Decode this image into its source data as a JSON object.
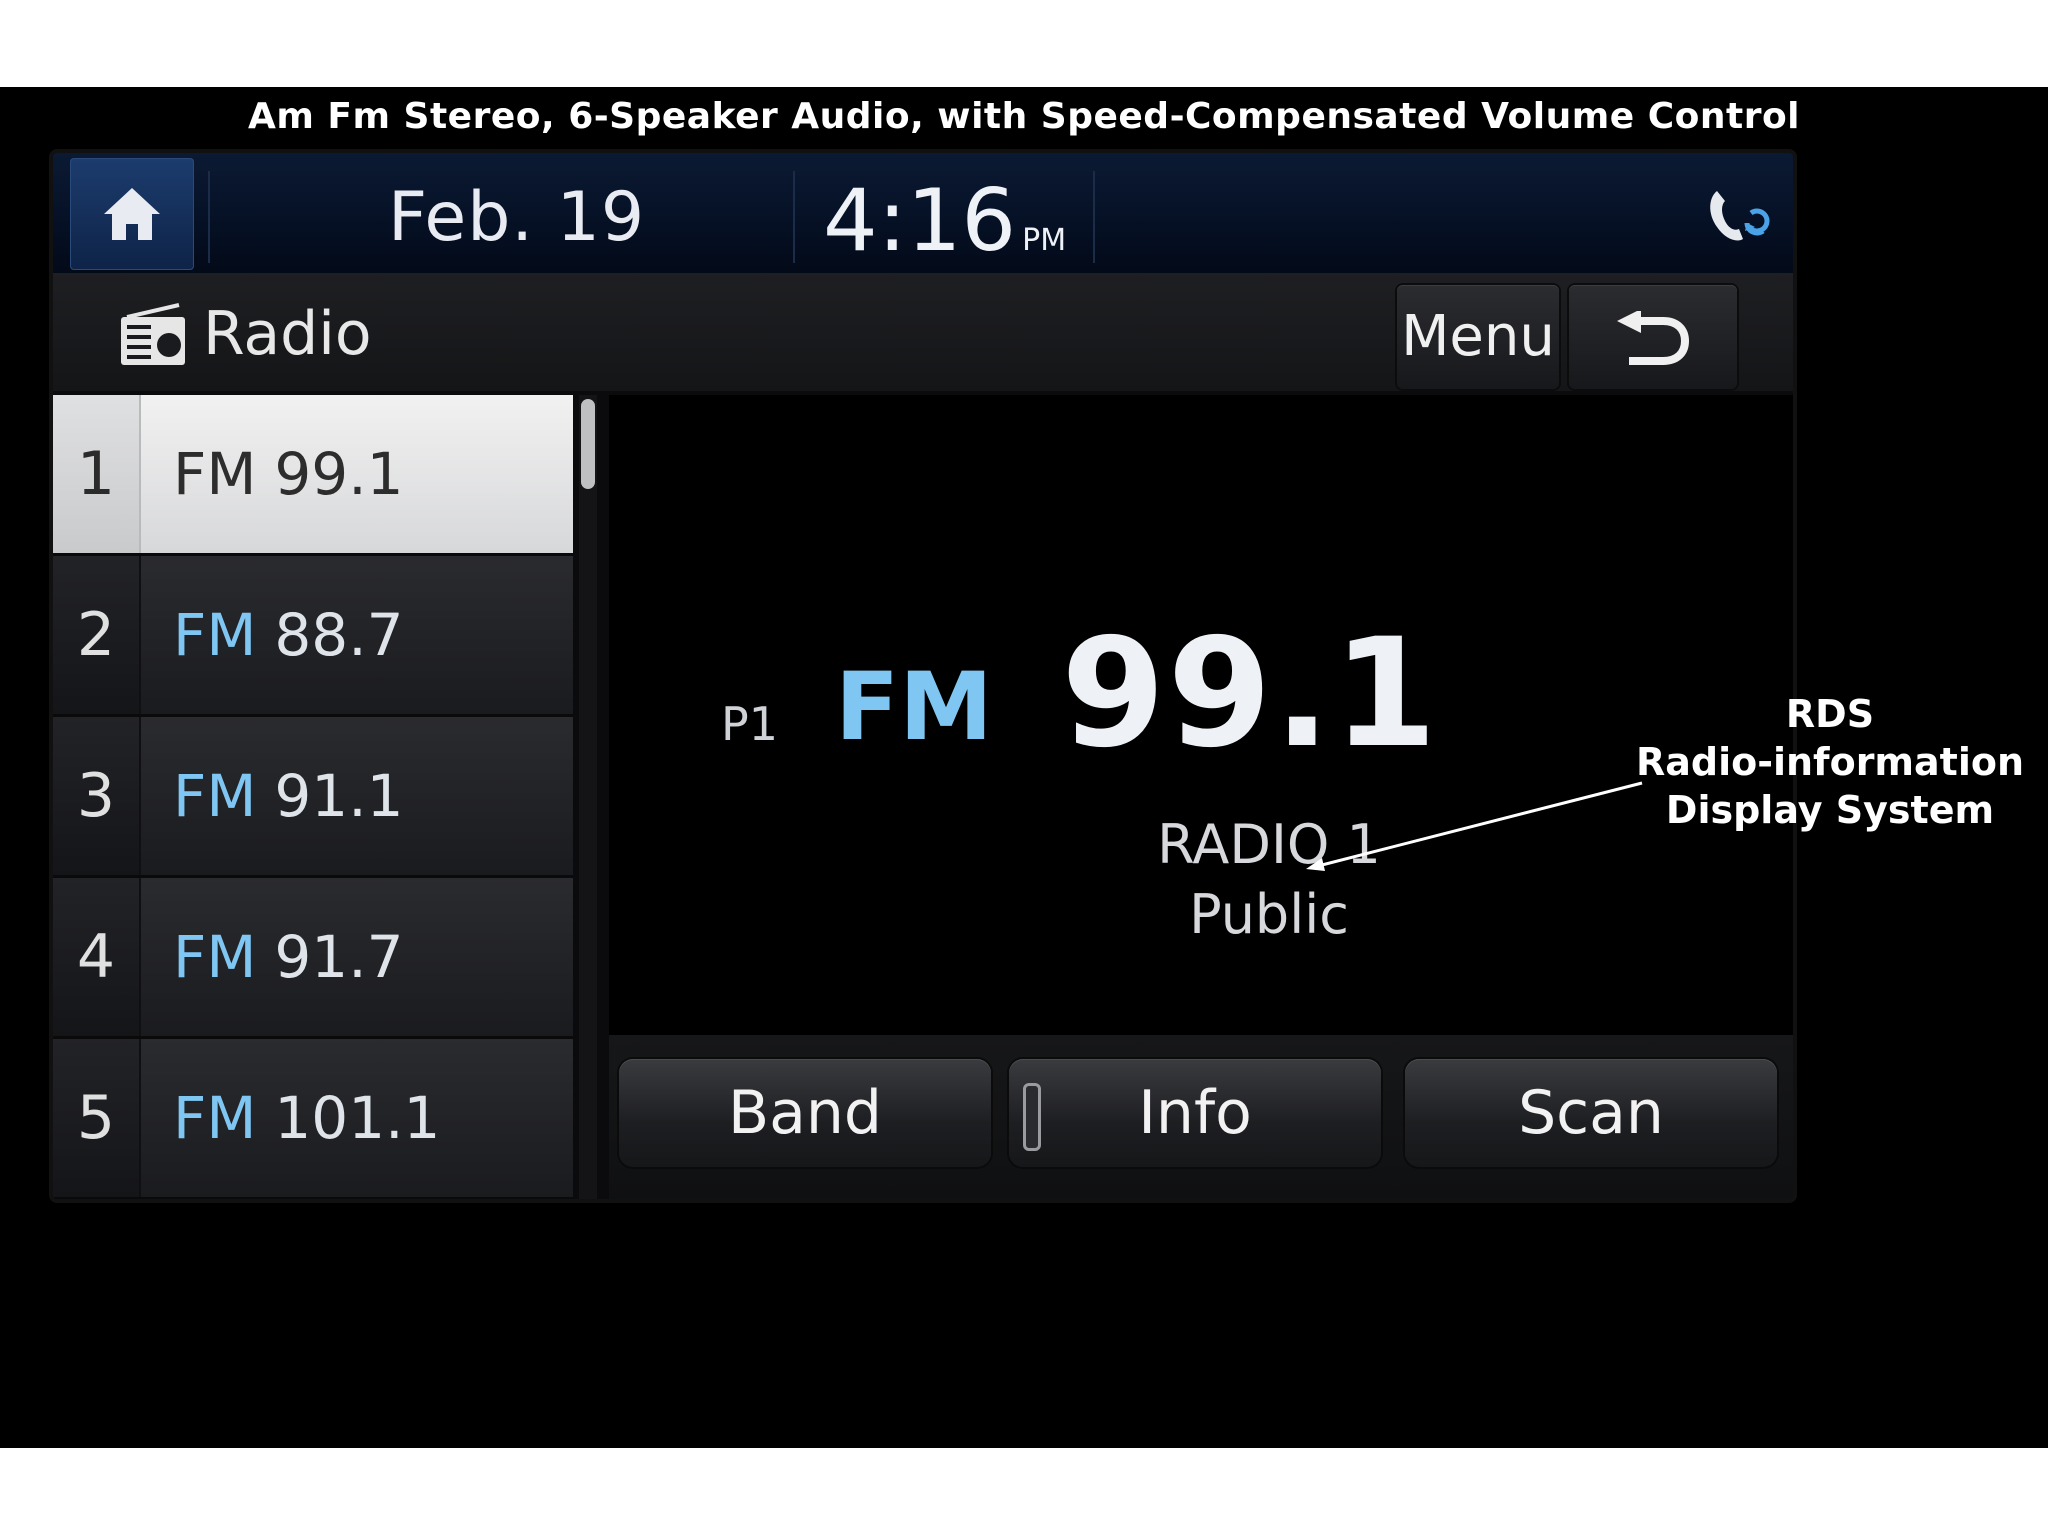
{
  "caption": "Am Fm Stereo, 6-Speaker Audio, with Speed-Compensated Volume Control",
  "status_bar": {
    "date": "Feb. 19",
    "time": "4:16",
    "ampm": "PM",
    "icons": [
      "home-icon",
      "phone-sync-icon"
    ]
  },
  "title_bar": {
    "title": "Radio",
    "menu_label": "Menu",
    "icons": [
      "radio-icon",
      "back-arrow-icon"
    ]
  },
  "presets": [
    {
      "number": "1",
      "band": "FM",
      "frequency": "99.1",
      "selected": true
    },
    {
      "number": "2",
      "band": "FM",
      "frequency": "88.7",
      "selected": false
    },
    {
      "number": "3",
      "band": "FM",
      "frequency": "91.1",
      "selected": false
    },
    {
      "number": "4",
      "band": "FM",
      "frequency": "91.7",
      "selected": false
    },
    {
      "number": "5",
      "band": "FM",
      "frequency": "101.1",
      "selected": false
    }
  ],
  "now_playing": {
    "preset": "P1",
    "band": "FM",
    "frequency": "99.1",
    "station_name": "RADIO 1",
    "program_type": "Public"
  },
  "buttons": {
    "band": "Band",
    "info": "Info",
    "scan": "Scan"
  },
  "annotation": {
    "line1": "RDS",
    "line2": "Radio-information",
    "line3": "Display System"
  },
  "colors": {
    "band_accent": "#7fc6f2",
    "status_bar": "#061126",
    "background": "#000000"
  }
}
